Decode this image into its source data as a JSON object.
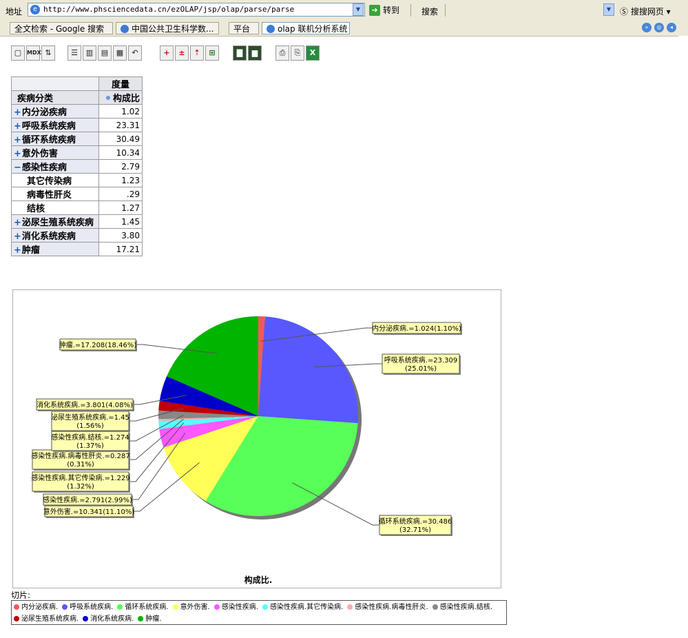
{
  "addressbar": {
    "label": "地址",
    "url": "http://www.phsciencedata.cn/ezOLAP/jsp/olap/parse/parse",
    "go_label": "转到",
    "search_label": "搜索",
    "sogou_label": "搜搜网页"
  },
  "tabs": [
    {
      "label": "全文检索 - Google 搜索"
    },
    {
      "label": "中国公共卫生科学数..."
    },
    {
      "label": "平台"
    },
    {
      "label": "olap 联机分析系统"
    }
  ],
  "toolbar": {
    "buttons": [
      {
        "name": "cube-icon",
        "glyph": "▢"
      },
      {
        "name": "mdx-button",
        "glyph": "MDX"
      },
      {
        "name": "sort-icon",
        "glyph": "⇅"
      },
      {
        "name": "layout-1-icon",
        "glyph": "☰"
      },
      {
        "name": "layout-2-icon",
        "glyph": "▥"
      },
      {
        "name": "layout-3-icon",
        "glyph": "▤"
      },
      {
        "name": "layout-4-icon",
        "glyph": "▦"
      },
      {
        "name": "swap-axes-icon",
        "glyph": "↶"
      },
      {
        "name": "drill-plus-icon",
        "glyph": "+"
      },
      {
        "name": "drill-minus-icon",
        "glyph": "±"
      },
      {
        "name": "drill-through-icon",
        "glyph": "⇡"
      },
      {
        "name": "expand-icon",
        "glyph": "⊞"
      },
      {
        "name": "chart-icon",
        "glyph": "▇"
      },
      {
        "name": "chart-settings-icon",
        "glyph": "▆"
      },
      {
        "name": "print-icon",
        "glyph": "⎙"
      },
      {
        "name": "print-preview-icon",
        "glyph": "⎘"
      },
      {
        "name": "excel-export-icon",
        "glyph": "X"
      }
    ]
  },
  "pivot": {
    "measure_header": "度量",
    "dimension_header": "疾病分类",
    "measure_name": "构成比",
    "rows": [
      {
        "label": "内分泌疾病",
        "sign": "+",
        "value": "1.02",
        "child": false
      },
      {
        "label": "呼吸系统疾病",
        "sign": "+",
        "value": "23.31",
        "child": false
      },
      {
        "label": "循环系统疾病",
        "sign": "+",
        "value": "30.49",
        "child": false
      },
      {
        "label": "意外伤害",
        "sign": "+",
        "value": "10.34",
        "child": false
      },
      {
        "label": "感染性疾病",
        "sign": "−",
        "value": "2.79",
        "child": false
      },
      {
        "label": "其它传染病",
        "sign": "",
        "value": "1.23",
        "child": true
      },
      {
        "label": "病毒性肝炎",
        "sign": "",
        "value": ".29",
        "child": true
      },
      {
        "label": "结核",
        "sign": "",
        "value": "1.27",
        "child": true
      },
      {
        "label": "泌尿生殖系统疾病",
        "sign": "+",
        "value": "1.45",
        "child": false
      },
      {
        "label": "消化系统疾病",
        "sign": "+",
        "value": "3.80",
        "child": false
      },
      {
        "label": "肿瘤",
        "sign": "+",
        "value": "17.21",
        "child": false
      }
    ]
  },
  "chart_data": {
    "type": "pie",
    "title": "构成比.",
    "slices": [
      {
        "name": "内分泌疾病.",
        "value": 1.024,
        "label": "内分泌疾病.=1.024(1.10%)",
        "color": "#f05a5a"
      },
      {
        "name": "呼吸系统疾病.",
        "value": 23.309,
        "label": "呼吸系统疾病.=23.309 (25.01%)",
        "color": "#5858ff"
      },
      {
        "name": "循环系统疾病.",
        "value": 30.486,
        "label": "循环系统疾病.=30.486 (32.71%)",
        "color": "#58ff58"
      },
      {
        "name": "意外伤害.",
        "value": 10.341,
        "label": "意外伤害.=10.341(11.10%)",
        "color": "#ffff58"
      },
      {
        "name": "感染性疾病.",
        "value": 2.791,
        "label": "感染性疾病.=2.791(2.99%)",
        "color": "#ff58ff"
      },
      {
        "name": "感染性疾病.其它传染病.",
        "value": 1.229,
        "label": "感染性疾病.其它传染病.=1.229 (1.32%)",
        "color": "#58ffff"
      },
      {
        "name": "感染性疾病.病毒性肝炎.",
        "value": 0.287,
        "label": "感染性疾病.病毒性肝炎.=0.287 (0.31%)",
        "color": "#ffaaaa"
      },
      {
        "name": "感染性疾病.结核.",
        "value": 1.274,
        "label": "感染性疾病.结核.=1.274 (1.37%)",
        "color": "#888888"
      },
      {
        "name": "泌尿生殖系统疾病.",
        "value": 1.45,
        "label": "泌尿生殖系统疾病.=1.45 (1.56%)",
        "color": "#c00000"
      },
      {
        "name": "消化系统疾病.",
        "value": 3.801,
        "label": "消化系统疾病.=3.801(4.08%)",
        "color": "#0000c8"
      },
      {
        "name": "肿瘤.",
        "value": 17.208,
        "label": "肿瘤.=17.208(18.46%)",
        "color": "#00b400"
      }
    ]
  },
  "slicer_label": "切片:"
}
